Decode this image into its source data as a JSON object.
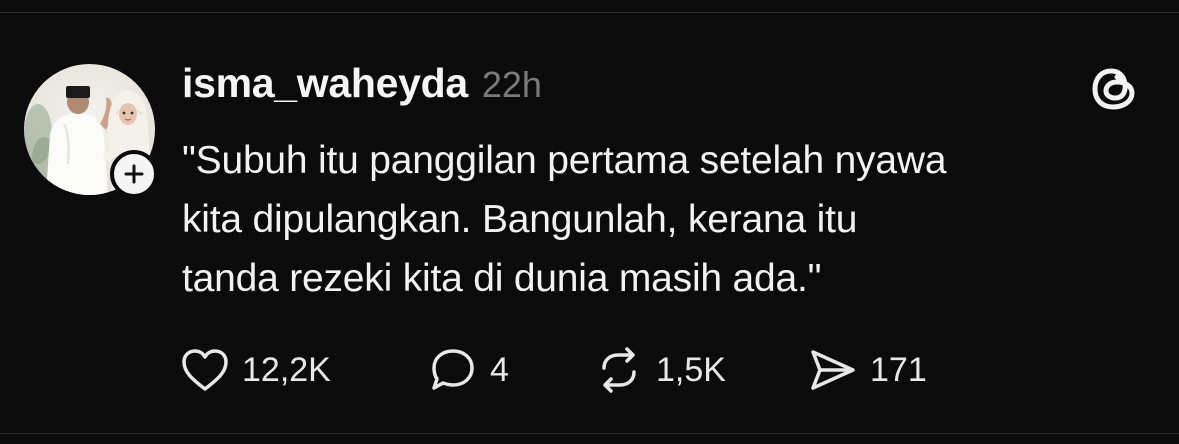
{
  "post": {
    "username": "isma_waheyda",
    "timestamp": "22h",
    "text_lines": [
      "\"Subuh itu panggilan pertama setelah nyawa",
      "kita dipulangkan. Bangunlah, kerana itu",
      "tanda rezeki kita di dunia masih ada.\""
    ]
  },
  "icons": {
    "avatar": "avatar-photo",
    "follow": "plus-icon",
    "brand": "threads-logo-icon",
    "like": "heart-icon",
    "reply": "comment-icon",
    "repost": "repost-icon",
    "share": "send-icon"
  },
  "actions": {
    "likes": "12,2K",
    "replies": "4",
    "reposts": "1,5K",
    "shares": "171"
  },
  "colors": {
    "background": "#0b0b0b",
    "text": "#f2f2f2",
    "muted": "#7a7a7a",
    "icon": "#e8e8e8"
  }
}
